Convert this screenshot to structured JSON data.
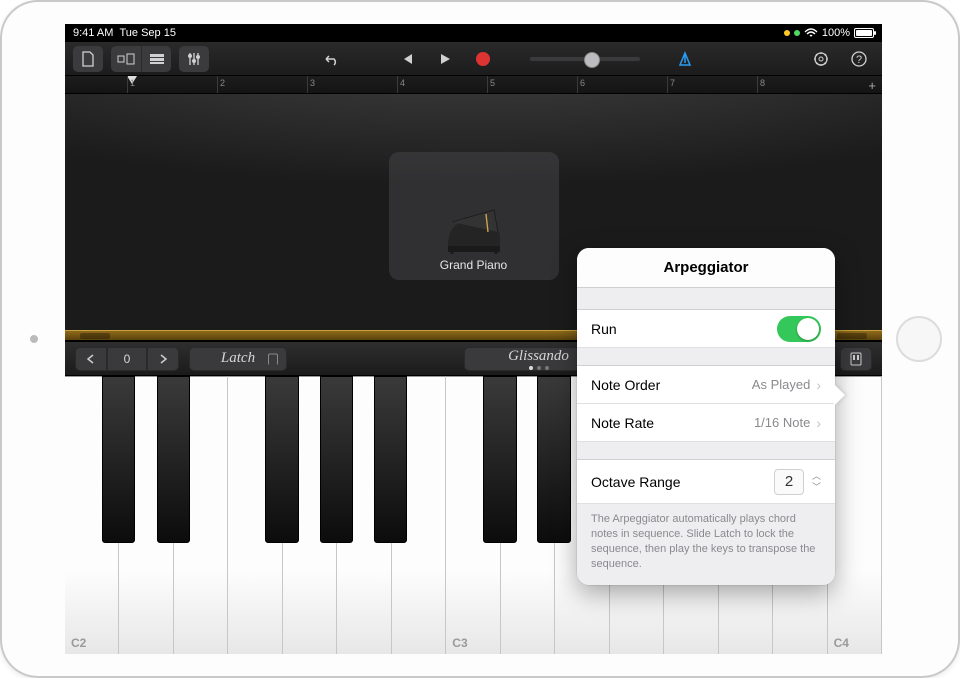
{
  "status": {
    "time": "9:41 AM",
    "date": "Tue Sep 15",
    "battery": "100%"
  },
  "ruler": {
    "marks": [
      "1",
      "2",
      "3",
      "4",
      "5",
      "6",
      "7",
      "8"
    ]
  },
  "instrument": {
    "name": "Grand Piano"
  },
  "controls": {
    "octave_value": "0",
    "latch_label": "Latch",
    "mode_label": "Glissando"
  },
  "key_labels": {
    "c2": "C2",
    "c3": "C3",
    "c4": "C4"
  },
  "popover": {
    "title": "Arpeggiator",
    "run_label": "Run",
    "run_on": true,
    "note_order_label": "Note Order",
    "note_order_value": "As Played",
    "note_rate_label": "Note Rate",
    "note_rate_value": "1/16 Note",
    "octave_range_label": "Octave Range",
    "octave_range_value": "2",
    "description": "The Arpeggiator automatically plays chord notes in sequence. Slide Latch to lock the sequence, then play the keys to transpose the sequence."
  }
}
